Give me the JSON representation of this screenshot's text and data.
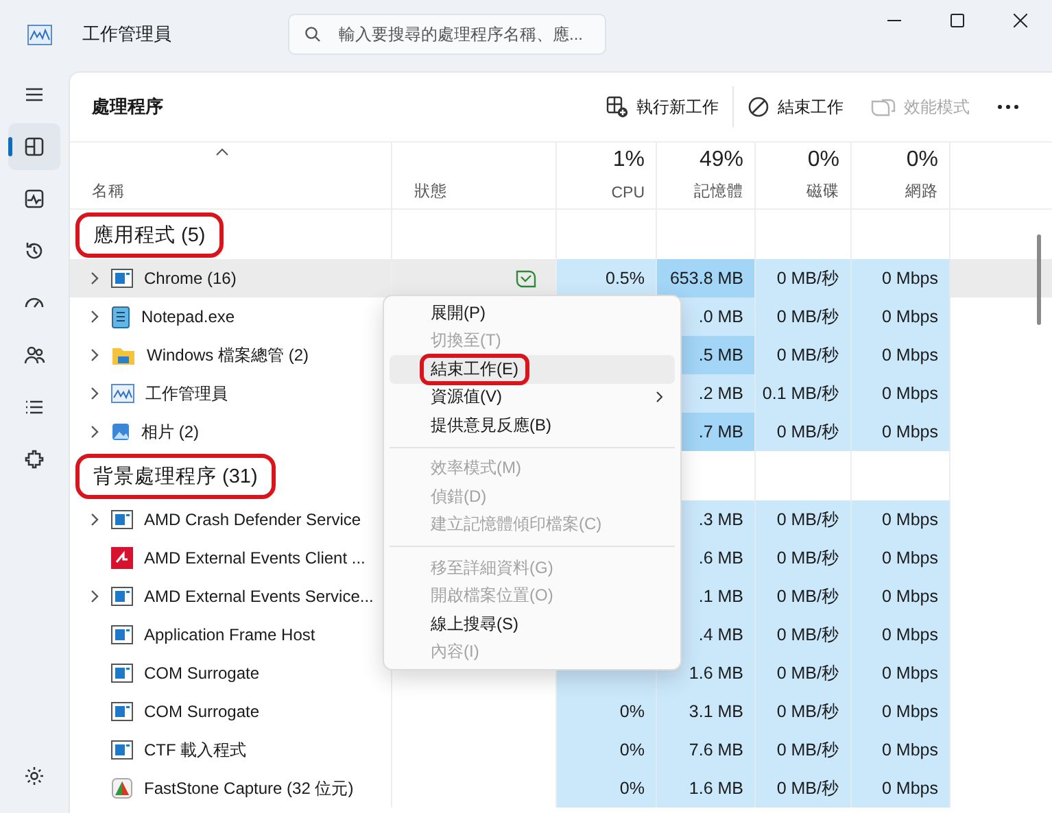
{
  "window": {
    "title": "工作管理員",
    "search": {
      "placeholder": "輸入要搜尋的處理程序名稱、應..."
    }
  },
  "sidebar": {
    "items": [
      {
        "selected": false
      },
      {
        "selected": true
      },
      {
        "selected": false
      },
      {
        "selected": false
      },
      {
        "selected": false
      },
      {
        "selected": false
      },
      {
        "selected": false
      },
      {
        "selected": false
      }
    ],
    "footer": {
      "selected": false
    }
  },
  "page": {
    "title": "處理程序",
    "toolbar": [
      {
        "kind": "run",
        "label": "執行新工作",
        "disabled": false
      },
      {
        "kind": "end",
        "label": "結束工作",
        "disabled": false
      },
      {
        "kind": "efficiency",
        "label": "效能模式",
        "disabled": true
      },
      {
        "kind": "more"
      }
    ]
  },
  "columns": [
    {
      "label": "名稱",
      "sorted": true
    },
    {
      "label": "狀態"
    },
    {
      "percent": "1%",
      "label": "CPU"
    },
    {
      "percent": "49%",
      "label": "記憶體"
    },
    {
      "percent": "0%",
      "label": "磁碟"
    },
    {
      "percent": "0%",
      "label": "網路"
    }
  ],
  "groups": [
    {
      "title": "應用程式 (5)",
      "annotated": true,
      "rows": [
        {
          "name": "Chrome (16)",
          "kind": "app",
          "expandable": true,
          "hovered": true,
          "efficiency": true,
          "cpu": "0.5%",
          "memory": "653.8 MB",
          "memory_high": true,
          "disk": "0 MB/秒",
          "network": "0 Mbps"
        },
        {
          "name": "Notepad.exe",
          "kind": "notepad",
          "expandable": true,
          "hovered": false,
          "efficiency": false,
          "memory": ".0 MB",
          "memory_high": false,
          "disk": "0 MB/秒",
          "network": "0 Mbps"
        },
        {
          "name": "Windows 檔案總管 (2)",
          "kind": "folder",
          "expandable": true,
          "hovered": false,
          "efficiency": false,
          "memory": ".5 MB",
          "memory_high": true,
          "disk": "0 MB/秒",
          "network": "0 Mbps"
        },
        {
          "name": "工作管理員",
          "kind": "taskmgr",
          "expandable": true,
          "hovered": false,
          "efficiency": false,
          "memory": ".2 MB",
          "memory_high": false,
          "disk": "0.1 MB/秒",
          "network": "0 Mbps"
        },
        {
          "name": "相片 (2)",
          "kind": "photos",
          "expandable": true,
          "hovered": false,
          "efficiency": false,
          "memory": ".7 MB",
          "memory_high": true,
          "disk": "0 MB/秒",
          "network": "0 Mbps"
        }
      ]
    },
    {
      "title": "背景處理程序 (31)",
      "annotated": true,
      "rows": [
        {
          "name": "AMD Crash Defender Service",
          "kind": "app",
          "expandable": true,
          "hovered": false,
          "efficiency": false,
          "memory": ".3 MB",
          "memory_high": false,
          "disk": "0 MB/秒",
          "network": "0 Mbps"
        },
        {
          "name": "AMD External Events Client ...",
          "kind": "amd",
          "expandable": false,
          "hovered": false,
          "efficiency": false,
          "memory": ".6 MB",
          "memory_high": false,
          "disk": "0 MB/秒",
          "network": "0 Mbps"
        },
        {
          "name": "AMD External Events Service...",
          "kind": "app",
          "expandable": true,
          "hovered": false,
          "efficiency": false,
          "memory": ".1 MB",
          "memory_high": false,
          "disk": "0 MB/秒",
          "network": "0 Mbps"
        },
        {
          "name": "Application Frame Host",
          "kind": "app",
          "expandable": false,
          "hovered": false,
          "efficiency": false,
          "memory": ".4 MB",
          "memory_high": false,
          "disk": "0 MB/秒",
          "network": "0 Mbps"
        },
        {
          "name": "COM Surrogate",
          "kind": "app",
          "expandable": false,
          "hovered": false,
          "efficiency": false,
          "memory": "1.6 MB",
          "memory_high": false,
          "disk": "0 MB/秒",
          "network": "0 Mbps"
        },
        {
          "name": "COM Surrogate",
          "kind": "app",
          "expandable": false,
          "hovered": false,
          "efficiency": false,
          "cpu": "0%",
          "memory": "3.1 MB",
          "memory_high": false,
          "disk": "0 MB/秒",
          "network": "0 Mbps"
        },
        {
          "name": "CTF 載入程式",
          "kind": "app",
          "expandable": false,
          "hovered": false,
          "efficiency": false,
          "cpu": "0%",
          "memory": "7.6 MB",
          "memory_high": false,
          "disk": "0 MB/秒",
          "network": "0 Mbps"
        },
        {
          "name": "FastStone Capture (32 位元)",
          "kind": "faststone",
          "expandable": false,
          "hovered": false,
          "efficiency": false,
          "cpu": "0%",
          "memory": "1.6 MB",
          "memory_high": false,
          "disk": "0 MB/秒",
          "network": "0 Mbps"
        }
      ]
    }
  ],
  "context_menu": {
    "items": [
      {
        "kind": "item",
        "label": "展開(P)",
        "disabled": false,
        "hovered": false,
        "annotated": false
      },
      {
        "kind": "item",
        "label": "切換至(T)",
        "disabled": true,
        "hovered": false,
        "annotated": false
      },
      {
        "kind": "item",
        "label": "結束工作(E)",
        "disabled": false,
        "hovered": true,
        "annotated": true
      },
      {
        "kind": "submenu",
        "label": "資源值(V)",
        "disabled": false,
        "hovered": false,
        "annotated": false
      },
      {
        "kind": "item",
        "label": "提供意見反應(B)",
        "disabled": false,
        "hovered": false,
        "annotated": false
      },
      {
        "kind": "separator"
      },
      {
        "kind": "item",
        "label": "效率模式(M)",
        "disabled": true,
        "hovered": false,
        "annotated": false
      },
      {
        "kind": "item",
        "label": "偵錯(D)",
        "disabled": true,
        "hovered": false,
        "annotated": false
      },
      {
        "kind": "item",
        "label": "建立記憶體傾印檔案(C)",
        "disabled": true,
        "hovered": false,
        "annotated": false
      },
      {
        "kind": "separator"
      },
      {
        "kind": "item",
        "label": "移至詳細資料(G)",
        "disabled": true,
        "hovered": false,
        "annotated": false
      },
      {
        "kind": "item",
        "label": "開啟檔案位置(O)",
        "disabled": true,
        "hovered": false,
        "annotated": false
      },
      {
        "kind": "item",
        "label": "線上搜尋(S)",
        "disabled": false,
        "hovered": false,
        "annotated": false
      },
      {
        "kind": "item",
        "label": "內容(I)",
        "disabled": true,
        "hovered": false,
        "annotated": false
      }
    ]
  }
}
